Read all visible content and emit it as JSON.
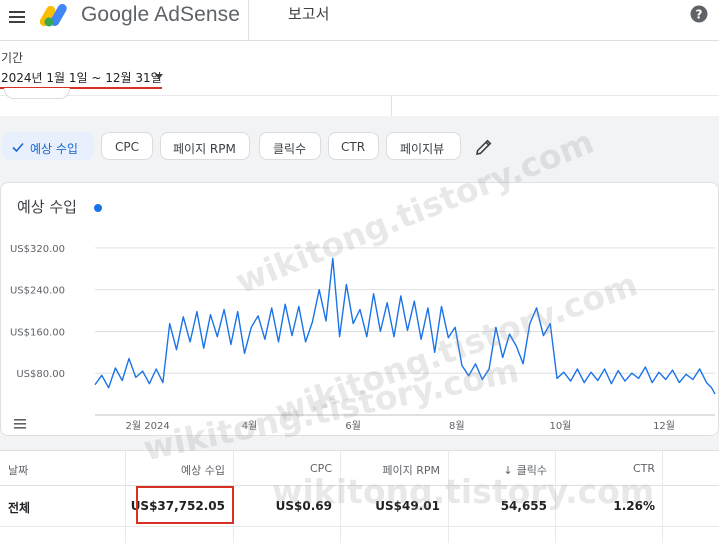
{
  "app": {
    "name": "Google AdSense",
    "page_title": "보고서"
  },
  "icons": {
    "menu": "hamburger-menu-icon",
    "logo": "adsense-logo-icon",
    "help": "help-icon",
    "check": "check-icon",
    "edit": "pencil-icon",
    "legend": "legend-menu-icon"
  },
  "period": {
    "label": "기간",
    "value": "2024년 1월 1일 ~ 12월 31일"
  },
  "metric_chips": [
    {
      "label": "예상 수입",
      "selected": true
    },
    {
      "label": "CPC",
      "selected": false
    },
    {
      "label": "페이지 RPM",
      "selected": false
    },
    {
      "label": "클릭수",
      "selected": false
    },
    {
      "label": "CTR",
      "selected": false
    },
    {
      "label": "페이지뷰",
      "selected": false
    }
  ],
  "chart": {
    "title": "예상 수입",
    "series_color": "#1a73e8"
  },
  "chart_data": {
    "type": "line",
    "ylim": [
      0,
      360
    ],
    "yticks": [
      {
        "value": 80,
        "label": "US$80.00"
      },
      {
        "value": 160,
        "label": "US$160.00"
      },
      {
        "value": 240,
        "label": "US$240.00"
      },
      {
        "value": 320,
        "label": "US$320.00"
      }
    ],
    "xticks": [
      {
        "date": "2024-02-01",
        "label": "2월 2024"
      },
      {
        "date": "2024-04-01",
        "label": "4월"
      },
      {
        "date": "2024-06-01",
        "label": "6월"
      },
      {
        "date": "2024-08-01",
        "label": "8월"
      },
      {
        "date": "2024-10-01",
        "label": "10월"
      },
      {
        "date": "2024-12-01",
        "label": "12월"
      }
    ],
    "x_range": [
      "2024-01-01",
      "2024-12-31"
    ],
    "series": [
      {
        "points": [
          [
            "2024-01-01",
            58
          ],
          [
            "2024-01-05",
            76
          ],
          [
            "2024-01-09",
            52
          ],
          [
            "2024-01-13",
            90
          ],
          [
            "2024-01-17",
            66
          ],
          [
            "2024-01-21",
            108
          ],
          [
            "2024-01-25",
            72
          ],
          [
            "2024-01-29",
            84
          ],
          [
            "2024-02-02",
            60
          ],
          [
            "2024-02-06",
            88
          ],
          [
            "2024-02-10",
            62
          ],
          [
            "2024-02-14",
            175
          ],
          [
            "2024-02-18",
            125
          ],
          [
            "2024-02-22",
            188
          ],
          [
            "2024-02-26",
            140
          ],
          [
            "2024-03-01",
            198
          ],
          [
            "2024-03-05",
            128
          ],
          [
            "2024-03-09",
            192
          ],
          [
            "2024-03-13",
            150
          ],
          [
            "2024-03-17",
            202
          ],
          [
            "2024-03-21",
            135
          ],
          [
            "2024-03-25",
            198
          ],
          [
            "2024-03-29",
            118
          ],
          [
            "2024-04-02",
            168
          ],
          [
            "2024-04-06",
            190
          ],
          [
            "2024-04-10",
            145
          ],
          [
            "2024-04-14",
            205
          ],
          [
            "2024-04-18",
            140
          ],
          [
            "2024-04-22",
            212
          ],
          [
            "2024-04-26",
            152
          ],
          [
            "2024-04-30",
            208
          ],
          [
            "2024-05-04",
            140
          ],
          [
            "2024-05-08",
            178
          ],
          [
            "2024-05-12",
            240
          ],
          [
            "2024-05-16",
            180
          ],
          [
            "2024-05-20",
            300
          ],
          [
            "2024-05-24",
            150
          ],
          [
            "2024-05-28",
            250
          ],
          [
            "2024-06-01",
            175
          ],
          [
            "2024-06-05",
            202
          ],
          [
            "2024-06-09",
            150
          ],
          [
            "2024-06-13",
            232
          ],
          [
            "2024-06-17",
            160
          ],
          [
            "2024-06-21",
            215
          ],
          [
            "2024-06-25",
            150
          ],
          [
            "2024-06-29",
            228
          ],
          [
            "2024-07-03",
            162
          ],
          [
            "2024-07-07",
            218
          ],
          [
            "2024-07-11",
            145
          ],
          [
            "2024-07-15",
            205
          ],
          [
            "2024-07-19",
            120
          ],
          [
            "2024-07-23",
            208
          ],
          [
            "2024-07-27",
            148
          ],
          [
            "2024-07-31",
            168
          ],
          [
            "2024-08-04",
            95
          ],
          [
            "2024-08-08",
            75
          ],
          [
            "2024-08-12",
            98
          ],
          [
            "2024-08-16",
            68
          ],
          [
            "2024-08-20",
            88
          ],
          [
            "2024-08-24",
            168
          ],
          [
            "2024-08-28",
            110
          ],
          [
            "2024-09-01",
            155
          ],
          [
            "2024-09-05",
            132
          ],
          [
            "2024-09-09",
            98
          ],
          [
            "2024-09-13",
            175
          ],
          [
            "2024-09-17",
            205
          ],
          [
            "2024-09-21",
            152
          ],
          [
            "2024-09-25",
            175
          ],
          [
            "2024-09-29",
            70
          ],
          [
            "2024-10-03",
            82
          ],
          [
            "2024-10-07",
            65
          ],
          [
            "2024-10-11",
            88
          ],
          [
            "2024-10-15",
            62
          ],
          [
            "2024-10-19",
            82
          ],
          [
            "2024-10-23",
            66
          ],
          [
            "2024-10-27",
            88
          ],
          [
            "2024-10-31",
            60
          ],
          [
            "2024-11-04",
            85
          ],
          [
            "2024-11-08",
            65
          ],
          [
            "2024-11-12",
            80
          ],
          [
            "2024-11-16",
            70
          ],
          [
            "2024-11-20",
            92
          ],
          [
            "2024-11-24",
            62
          ],
          [
            "2024-11-28",
            82
          ],
          [
            "2024-12-02",
            68
          ],
          [
            "2024-12-06",
            86
          ],
          [
            "2024-12-10",
            62
          ],
          [
            "2024-12-14",
            78
          ],
          [
            "2024-12-18",
            68
          ],
          [
            "2024-12-22",
            88
          ],
          [
            "2024-12-26",
            62
          ],
          [
            "2024-12-29",
            52
          ],
          [
            "2024-12-31",
            40
          ]
        ]
      }
    ]
  },
  "table": {
    "headers": [
      "날짜",
      "예상 수입",
      "CPC",
      "페이지 RPM",
      "클릭수",
      "CTR"
    ],
    "total_row": {
      "label": "전체",
      "estimated_earnings": "US$37,752.05",
      "cpc": "US$0.69",
      "page_rpm": "US$49.01",
      "clicks": "54,655",
      "ctr": "1.26%"
    }
  },
  "watermark": "wikitong.tistory.com",
  "colors": {
    "accent_blue": "#1a73e8",
    "highlight_red": "#d93025",
    "chip_selected_bg": "#e8f0fe"
  }
}
